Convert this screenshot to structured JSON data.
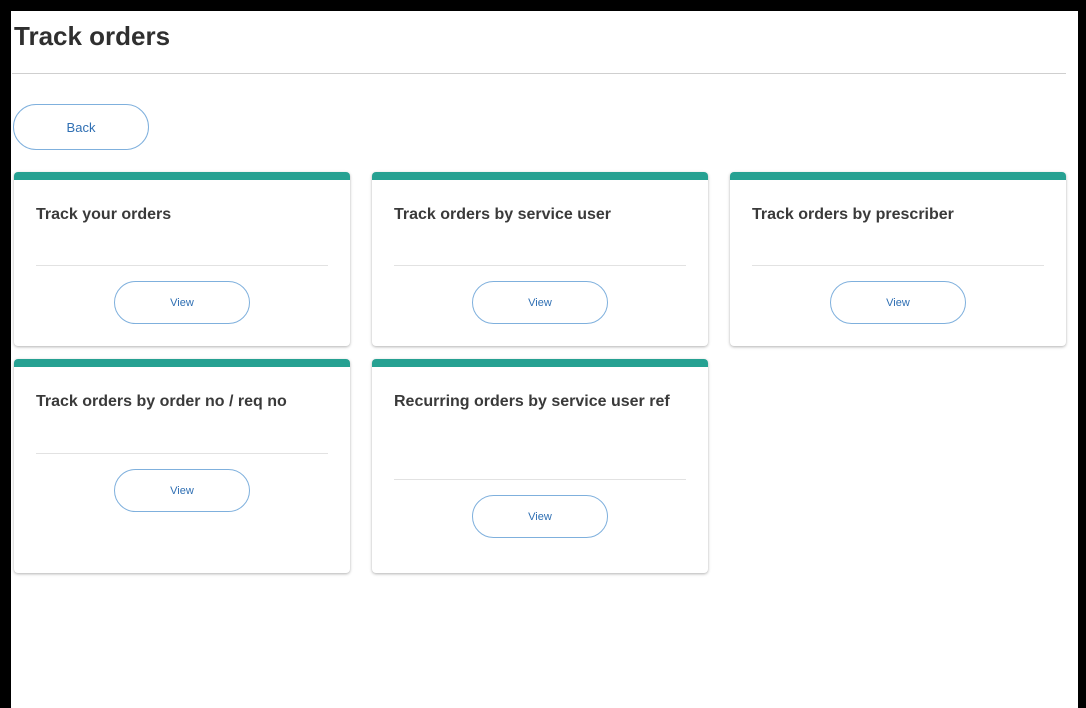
{
  "page": {
    "title": "Track orders",
    "back_label": "Back"
  },
  "cards": [
    {
      "title": "Track your orders",
      "button_label": "View"
    },
    {
      "title": "Track orders by service user",
      "button_label": "View"
    },
    {
      "title": "Track orders by prescriber",
      "button_label": "View"
    },
    {
      "title": "Track orders by order no / req no",
      "button_label": "View"
    },
    {
      "title": "Recurring orders by service user ref",
      "button_label": "View"
    }
  ],
  "colors": {
    "accent": "#26a192",
    "button_border": "#7fb0dd",
    "button_text": "#2f6fb3"
  }
}
